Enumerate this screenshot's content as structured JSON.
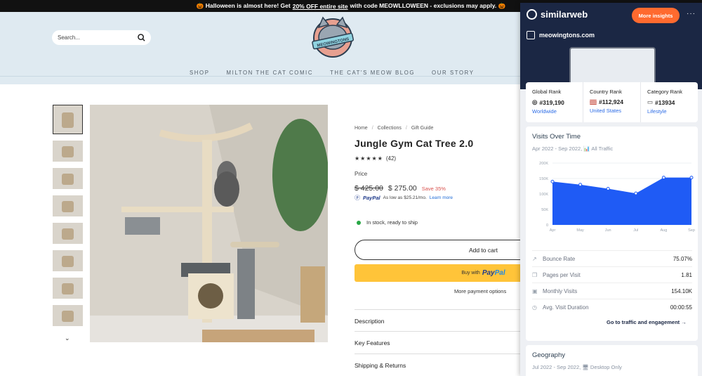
{
  "banner": {
    "pre": "🎃 Halloween is almost here! Get",
    "link": "20% OFF entire site",
    "post": "with code MEOWLLOWEEN - exclusions may apply. 🎃"
  },
  "header": {
    "search_placeholder": "Search...",
    "logo_text": "MEOWINGTONS"
  },
  "nav": [
    "SHOP",
    "MILTON THE CAT COMIC",
    "THE CAT'S MEOW BLOG",
    "OUR STORY"
  ],
  "product": {
    "breadcrumb": [
      "Home",
      "Collections",
      "Gift Guide"
    ],
    "title": "Jungle Gym Cat Tree 2.0",
    "stars": "★★★★★",
    "reviews": "(42)",
    "rating": 4.5,
    "price_label": "Price",
    "old_price": "$ 425.00",
    "new_price": "$ 275.00",
    "save": "Save 35%",
    "paypal_brand": "PayPal",
    "paypal_text": "As low as $25.21/mo.",
    "learn_more": "Learn more",
    "stock": "In stock, ready to ship",
    "add_to_cart": "Add to cart",
    "buy_with": "Buy with",
    "more_payment": "More payment options",
    "accordions": [
      "Description",
      "Key Features",
      "Shipping & Returns"
    ]
  },
  "similarweb": {
    "brand": "similarweb",
    "insights": "More insights",
    "more": "···",
    "domain": "meowingtons.com",
    "ranks": [
      {
        "title": "Global Rank",
        "value": "#319,190",
        "sub": "Worldwide",
        "icon": "globe-icon"
      },
      {
        "title": "Country Rank",
        "value": "#112,924",
        "sub": "United States",
        "icon": "us-flag-icon"
      },
      {
        "title": "Category Rank",
        "value": "#13934",
        "sub": "Lifestyle",
        "icon": "category-icon"
      }
    ],
    "visits": {
      "title": "Visits Over Time",
      "sub": "Apr 2022 - Sep 2022, 📊 All Traffic",
      "stats": [
        {
          "label": "Bounce Rate",
          "value": "75.07%",
          "icon": "bounce-icon"
        },
        {
          "label": "Pages per Visit",
          "value": "1.81",
          "icon": "pages-icon"
        },
        {
          "label": "Monthly Visits",
          "value": "154.10K",
          "icon": "visits-icon"
        },
        {
          "label": "Avg. Visit Duration",
          "value": "00:00:55",
          "icon": "clock-icon"
        }
      ],
      "goto": "Go to traffic and engagement →"
    },
    "geo": {
      "title": "Geography",
      "sub": "Jul 2022 - Sep 2022, 🖥 Desktop Only"
    }
  },
  "chart_data": {
    "type": "area",
    "x": [
      "Apr",
      "May",
      "Jun",
      "Jul",
      "Aug",
      "Sep"
    ],
    "values": [
      140,
      130,
      117,
      102,
      153,
      153
    ],
    "ylim": [
      0,
      200
    ],
    "yticks": [
      "0",
      "50K",
      "100K",
      "150K",
      "200K"
    ],
    "color": "#1f5bf5"
  }
}
